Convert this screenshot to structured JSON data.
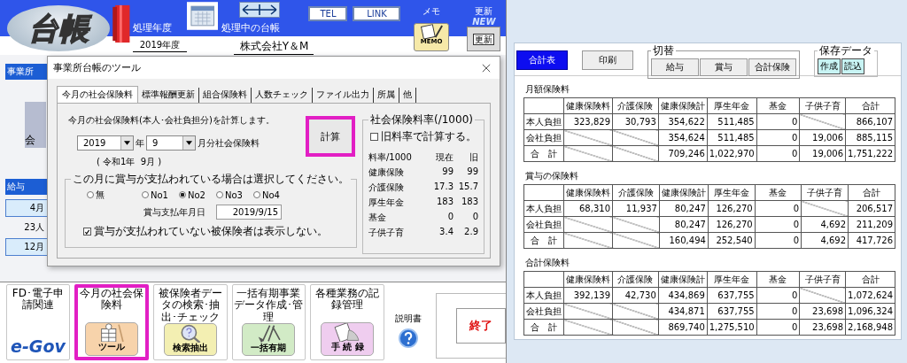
{
  "header": {
    "logo": "台帳",
    "year_label": "処理年度",
    "year": "2019年度",
    "ledger_label": "処理中の台帳",
    "company": "株式会社Y＆M",
    "links": [
      "TEL",
      "LINK"
    ],
    "memo_label": "メモ",
    "memo_icon_text": "MEMO",
    "update_label": "更新",
    "update_badge": "NEW",
    "update_icon_text": "更新"
  },
  "background_fragments": {
    "section_header": "事業所",
    "icon_text": "会",
    "salary_header": "給与",
    "month_1": "4月",
    "count": "23人",
    "month_2": "12月"
  },
  "dialog": {
    "title": "事業所台帳のツール",
    "tabs": [
      {
        "label": "今月の社会保険料",
        "selected": true
      },
      {
        "label": "標準報酬更新",
        "selected": false
      },
      {
        "label": "組合保険料",
        "selected": false
      },
      {
        "label": "人数チェック",
        "selected": false
      },
      {
        "label": "ファイル出力",
        "selected": false
      },
      {
        "label": "所属",
        "selected": false
      },
      {
        "label": "他",
        "selected": false
      }
    ],
    "intro": "今月の社会保険料(本人･会社負担分)を計算します。",
    "year": "2019",
    "year_unit": "年",
    "month": "9",
    "month_unit": "月分社会保険料",
    "era": "( 令和1年  9月 )",
    "calc_button": {
      "label": "計算",
      "highlighted": true
    },
    "bonus": {
      "legend": "この月に賞与が支払われている場合は選択してください。",
      "options": [
        {
          "label": "無",
          "selected": false
        },
        {
          "label": "No1",
          "selected": false
        },
        {
          "label": "No2",
          "selected": true
        },
        {
          "label": "No3",
          "selected": false
        },
        {
          "label": "No4",
          "selected": false
        }
      ],
      "date_label": "賞与支払年月日",
      "date": "2019/9/15",
      "hide_unpaid": {
        "label": "賞与が支払われていない被保険者は表示しない。",
        "checked": true
      }
    },
    "rates": {
      "legend": "社会保険料率(/1000)",
      "use_old": {
        "label": "旧料率で計算する。",
        "checked": false
      },
      "columns": [
        "料率/1000",
        "現在",
        "旧"
      ],
      "rows": [
        [
          "健康保険",
          "99",
          "99"
        ],
        [
          "介護保険",
          "17.3",
          "15.7"
        ],
        [
          "厚生年金",
          "183",
          "183"
        ],
        [
          "基金",
          "0",
          "0"
        ],
        [
          "子供子育",
          "3.4",
          "2.9"
        ]
      ]
    }
  },
  "tiles": [
    {
      "label": "FD･電子申請関連",
      "image_text": "e-Gov",
      "kind": "egov",
      "selected": false
    },
    {
      "label": "今月の社会保険料",
      "image_text": "ツール",
      "kind": "tool",
      "selected": true
    },
    {
      "label": "被保険者データの検索･抽出･チェック",
      "image_text": "検索抽出",
      "kind": "search",
      "selected": false
    },
    {
      "label": "一括有期事業データ作成･管理",
      "image_text": "一括有期",
      "kind": "shovel",
      "selected": false
    },
    {
      "label": "各種業務の記録管理",
      "image_text": "手 続 録",
      "kind": "record",
      "selected": false
    }
  ],
  "manual_label": "説明書",
  "exit_button": "終了",
  "report": {
    "toolbar": [
      {
        "label": "合計表",
        "selected": true
      },
      {
        "label": "印刷",
        "selected": false
      }
    ],
    "switch_group": {
      "legend": "切替",
      "buttons": [
        "給与",
        "賞与",
        "合計保険"
      ]
    },
    "save_group": {
      "legend": "保存データ",
      "buttons": [
        "作成",
        "読込"
      ]
    },
    "sections": [
      {
        "title": "月額保険料",
        "columns": [
          "健康保険料",
          "介護保険",
          "健康保険計",
          "厚生年金",
          "基金",
          "子供子育",
          "合計"
        ],
        "rows": [
          {
            "label": "本人負担",
            "cells": [
              "323,829",
              "30,793",
              "354,622",
              "511,485",
              "0",
              null,
              "866,107"
            ]
          },
          {
            "label": "会社負担",
            "cells": [
              null,
              null,
              "354,624",
              "511,485",
              "0",
              "19,006",
              "885,115"
            ]
          },
          {
            "label": "合　計",
            "cells": [
              null,
              null,
              "709,246",
              "1,022,970",
              "0",
              "19,006",
              "1,751,222"
            ]
          }
        ]
      },
      {
        "title": "賞与の保険料",
        "columns": [
          "健康保険料",
          "介護保険",
          "健康保険計",
          "厚生年金",
          "基金",
          "子供子育",
          "合計"
        ],
        "rows": [
          {
            "label": "本人負担",
            "cells": [
              "68,310",
              "11,937",
              "80,247",
              "126,270",
              "0",
              null,
              "206,517"
            ]
          },
          {
            "label": "会社負担",
            "cells": [
              null,
              null,
              "80,247",
              "126,270",
              "0",
              "4,692",
              "211,209"
            ]
          },
          {
            "label": "合　計",
            "cells": [
              null,
              null,
              "160,494",
              "252,540",
              "0",
              "4,692",
              "417,726"
            ]
          }
        ]
      },
      {
        "title": "合計保険料",
        "columns": [
          "健康保険料",
          "介護保険",
          "健康保険計",
          "厚生年金",
          "基金",
          "子供子育",
          "合計"
        ],
        "rows": [
          {
            "label": "本人負担",
            "cells": [
              "392,139",
              "42,730",
              "434,869",
              "637,755",
              "0",
              null,
              "1,072,624"
            ]
          },
          {
            "label": "会社負担",
            "cells": [
              null,
              null,
              "434,871",
              "637,755",
              "0",
              "23,698",
              "1,096,324"
            ]
          },
          {
            "label": "合　計",
            "cells": [
              null,
              null,
              "869,740",
              "1,275,510",
              "0",
              "23,698",
              "2,168,948"
            ]
          }
        ]
      }
    ]
  }
}
